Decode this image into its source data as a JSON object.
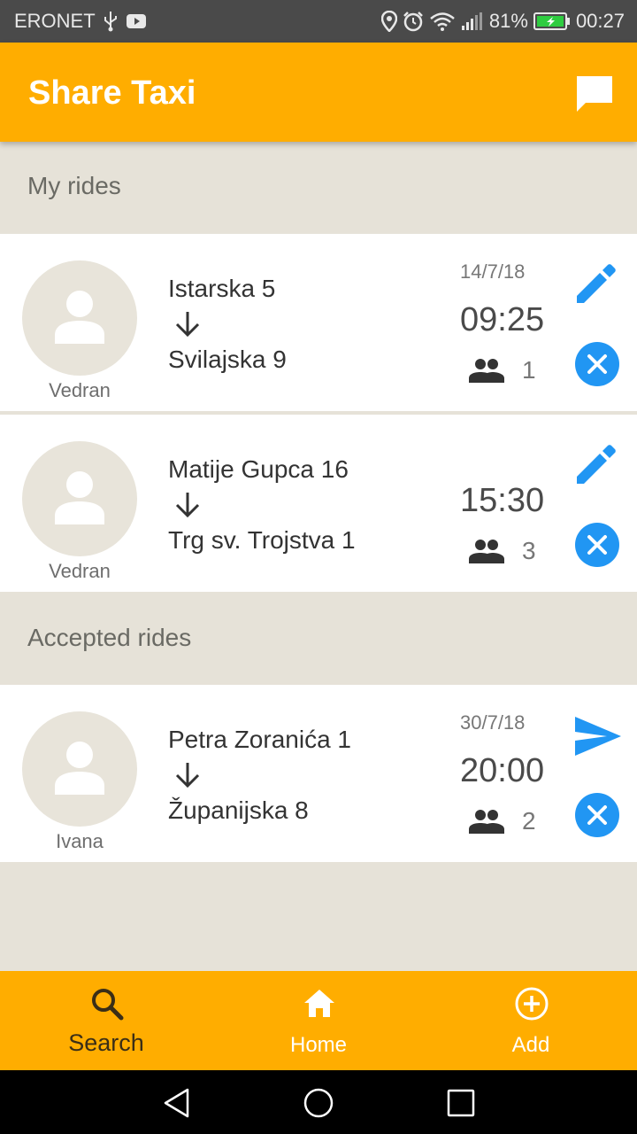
{
  "status_bar": {
    "carrier": "ERONET",
    "battery_percent": "81%",
    "time": "00:27"
  },
  "app_bar": {
    "title": "Share Taxi",
    "action_icon": "chat-icon"
  },
  "sections": {
    "my_rides_label": "My rides",
    "accepted_rides_label": "Accepted rides"
  },
  "my_rides": [
    {
      "driver": "Vedran",
      "from": "Istarska 5",
      "to": "Svilajska 9",
      "date": "14/7/18",
      "time": "09:25",
      "seats": "1"
    },
    {
      "driver": "Vedran",
      "from": "Matije Gupca 16",
      "to": "Trg sv. Trojstva 1",
      "date": "",
      "time": "15:30",
      "seats": "3"
    }
  ],
  "accepted_rides": [
    {
      "driver": "Ivana",
      "from": "Petra Zoranića 1",
      "to": "Županijska 8",
      "date": "30/7/18",
      "time": "20:00",
      "seats": "2"
    }
  ],
  "bottom_nav": {
    "search_label": "Search",
    "home_label": "Home",
    "add_label": "Add"
  },
  "colors": {
    "primary": "#ffad00",
    "accent": "#2196f3",
    "background": "#e6e2d8",
    "nav_active_text": "#3a2e17",
    "nav_inactive_text": "#ffffff"
  }
}
